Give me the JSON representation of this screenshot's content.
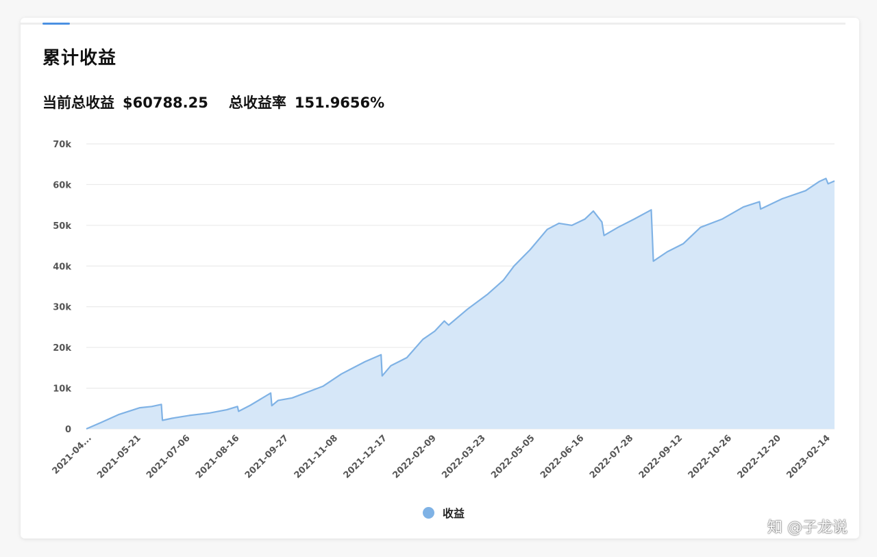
{
  "title": "累计收益",
  "summary": {
    "total_label": "当前总收益",
    "total_value": "$60788.25",
    "rate_label": "总收益率",
    "rate_value": "151.9656%"
  },
  "legend": {
    "label": "收益"
  },
  "watermark": "知 @子龙说",
  "colors": {
    "line": "#7fb2e5",
    "fill": "#d6e7f8",
    "accent": "#4a90e2",
    "grid": "#e6e6e6"
  },
  "chart_data": {
    "type": "area",
    "x_tick_labels": [
      "2021-04...",
      "2021-05-21",
      "2021-07-06",
      "2021-08-16",
      "2021-09-27",
      "2021-11-08",
      "2021-12-17",
      "2022-02-09",
      "2022-03-23",
      "2022-05-05",
      "2022-06-16",
      "2022-07-28",
      "2022-09-12",
      "2022-10-26",
      "2022-12-20",
      "2023-02-14"
    ],
    "y_tick_labels": [
      "0",
      "10k",
      "20k",
      "30k",
      "40k",
      "50k",
      "60k",
      "70k"
    ],
    "ylim": [
      0,
      70000
    ],
    "series": [
      {
        "name": "收益",
        "points": [
          [
            "2021-04-01",
            0
          ],
          [
            "2021-04-15",
            1600
          ],
          [
            "2021-05-01",
            3500
          ],
          [
            "2021-05-21",
            5200
          ],
          [
            "2021-06-01",
            5500
          ],
          [
            "2021-06-10",
            6000
          ],
          [
            "2021-06-11",
            2100
          ],
          [
            "2021-06-20",
            2600
          ],
          [
            "2021-07-06",
            3300
          ],
          [
            "2021-07-25",
            3900
          ],
          [
            "2021-08-10",
            4700
          ],
          [
            "2021-08-20",
            5500
          ],
          [
            "2021-08-21",
            4300
          ],
          [
            "2021-09-01",
            5800
          ],
          [
            "2021-09-20",
            8800
          ],
          [
            "2021-09-21",
            5700
          ],
          [
            "2021-09-27",
            7000
          ],
          [
            "2021-10-10",
            7600
          ],
          [
            "2021-11-08",
            10500
          ],
          [
            "2021-11-25",
            13500
          ],
          [
            "2021-12-17",
            16500
          ],
          [
            "2022-01-01",
            18200
          ],
          [
            "2022-01-02",
            13000
          ],
          [
            "2022-01-10",
            15500
          ],
          [
            "2022-01-25",
            17500
          ],
          [
            "2022-02-09",
            22000
          ],
          [
            "2022-02-20",
            24000
          ],
          [
            "2022-03-01",
            26500
          ],
          [
            "2022-03-05",
            25500
          ],
          [
            "2022-03-23",
            29500
          ],
          [
            "2022-04-10",
            33000
          ],
          [
            "2022-04-25",
            36500
          ],
          [
            "2022-05-05",
            40000
          ],
          [
            "2022-05-20",
            44000
          ],
          [
            "2022-06-05",
            49000
          ],
          [
            "2022-06-16",
            50500
          ],
          [
            "2022-06-28",
            50000
          ],
          [
            "2022-07-10",
            51500
          ],
          [
            "2022-07-18",
            53500
          ],
          [
            "2022-07-26",
            50800
          ],
          [
            "2022-07-28",
            47500
          ],
          [
            "2022-08-10",
            49500
          ],
          [
            "2022-08-25",
            51500
          ],
          [
            "2022-09-10",
            53800
          ],
          [
            "2022-09-12",
            41200
          ],
          [
            "2022-09-25",
            43500
          ],
          [
            "2022-10-10",
            45500
          ],
          [
            "2022-10-26",
            49500
          ],
          [
            "2022-11-15",
            51500
          ],
          [
            "2022-12-05",
            54500
          ],
          [
            "2022-12-20",
            55800
          ],
          [
            "2022-12-21",
            54000
          ],
          [
            "2023-01-10",
            56500
          ],
          [
            "2023-02-01",
            58500
          ],
          [
            "2023-02-14",
            60800
          ],
          [
            "2023-02-20",
            61500
          ],
          [
            "2023-02-22",
            60200
          ],
          [
            "2023-02-28",
            60900
          ]
        ]
      }
    ]
  }
}
